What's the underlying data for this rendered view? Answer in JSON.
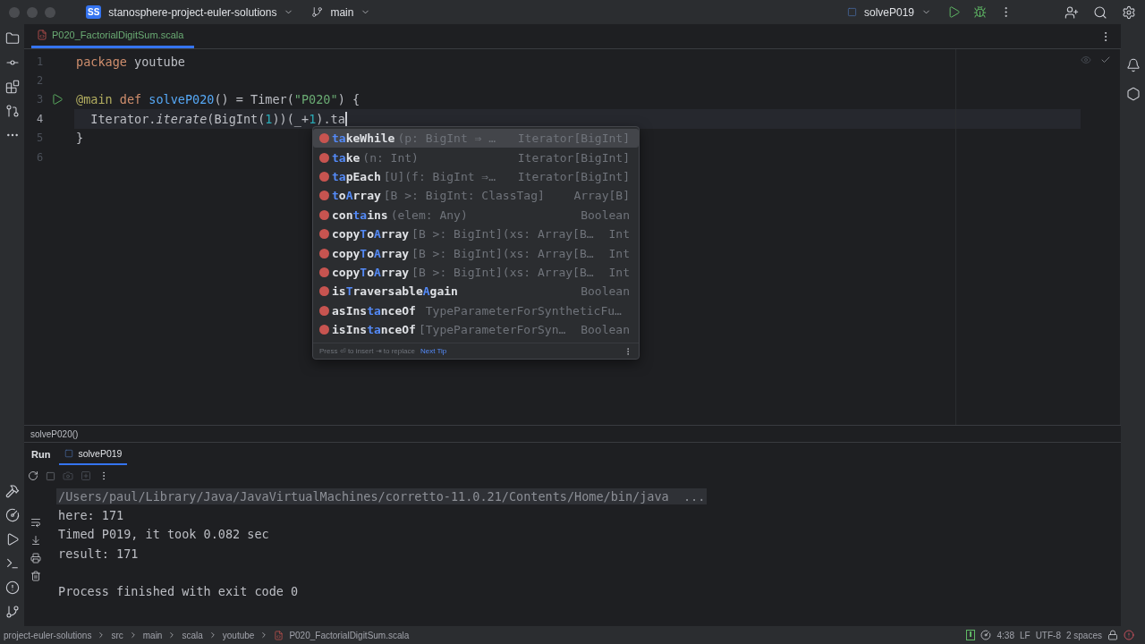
{
  "title_bar": {
    "project_badge": "SS",
    "project": "stanosphere-project-euler-solutions",
    "branch": "main",
    "run_config": "solveP019"
  },
  "editor_tabs": [
    {
      "label": "P020_FactorialDigitSum.scala",
      "selected": true
    }
  ],
  "code_lines": [
    {
      "number": "1",
      "run": false,
      "tokens": [
        {
          "text": "package",
          "kind": "keyword"
        },
        {
          "text": " youtube",
          "kind": "plain"
        }
      ]
    },
    {
      "number": "2",
      "run": false
    },
    {
      "number": "3",
      "run": true,
      "tokens": [
        {
          "text": "@main",
          "kind": "annotation"
        },
        {
          "text": " def ",
          "kind": "keyword"
        },
        {
          "text": "solveP020",
          "kind": "def"
        },
        {
          "text": "() = Timer(",
          "kind": "plain"
        },
        {
          "text": "\"P020\"",
          "kind": "string"
        },
        {
          "text": ") {",
          "kind": "plain"
        }
      ]
    },
    {
      "number": "4",
      "run": false,
      "current": true,
      "tokens": [
        {
          "text": "  Iterator.",
          "kind": "plain"
        },
        {
          "text": "iterate",
          "kind": "italic"
        },
        {
          "text": "(BigInt(",
          "kind": "plain"
        },
        {
          "text": "1",
          "kind": "number"
        },
        {
          "text": "))(_+",
          "kind": "plain"
        },
        {
          "text": "1",
          "kind": "number"
        },
        {
          "text": ").ta",
          "kind": "plain"
        }
      ]
    },
    {
      "number": "5",
      "run": false,
      "tokens": [
        {
          "text": "}",
          "kind": "plain"
        }
      ]
    },
    {
      "number": "6",
      "run": false
    }
  ],
  "completion": {
    "items": [
      {
        "name": [
          {
            "text": "ta",
            "match": true
          },
          {
            "text": "keWhile",
            "match": false
          }
        ],
        "signature": "(p: BigInt ⇒ …",
        "type": "Iterator[BigInt]",
        "selected": true
      },
      {
        "name": [
          {
            "text": "ta",
            "match": true
          },
          {
            "text": "ke",
            "match": false
          }
        ],
        "signature": "(n: Int)",
        "type": "Iterator[BigInt]",
        "selected": false
      },
      {
        "name": [
          {
            "text": "ta",
            "match": true
          },
          {
            "text": "pEach",
            "match": false
          }
        ],
        "signature": "[U](f: BigInt ⇒…",
        "type": "Iterator[BigInt]",
        "selected": false
      },
      {
        "name": [
          {
            "text": "t",
            "match": true
          },
          {
            "text": "o",
            "match": false
          },
          {
            "text": "A",
            "match": true
          },
          {
            "text": "rray",
            "match": false
          }
        ],
        "signature": "[B >: BigInt: ClassTag]",
        "type": "Array[B]",
        "selected": false
      },
      {
        "name": [
          {
            "text": "con",
            "match": false
          },
          {
            "text": "ta",
            "match": true
          },
          {
            "text": "ins",
            "match": false
          }
        ],
        "signature": "(elem: Any)",
        "type": "Boolean",
        "selected": false
      },
      {
        "name": [
          {
            "text": "copy",
            "match": false
          },
          {
            "text": "T",
            "match": true
          },
          {
            "text": "o",
            "match": false
          },
          {
            "text": "A",
            "match": true
          },
          {
            "text": "rray",
            "match": false
          }
        ],
        "signature": "[B >: BigInt](xs: Array[B…",
        "type": "Int",
        "selected": false
      },
      {
        "name": [
          {
            "text": "copy",
            "match": false
          },
          {
            "text": "T",
            "match": true
          },
          {
            "text": "o",
            "match": false
          },
          {
            "text": "A",
            "match": true
          },
          {
            "text": "rray",
            "match": false
          }
        ],
        "signature": "[B >: BigInt](xs: Array[B…",
        "type": "Int",
        "selected": false
      },
      {
        "name": [
          {
            "text": "copy",
            "match": false
          },
          {
            "text": "T",
            "match": true
          },
          {
            "text": "o",
            "match": false
          },
          {
            "text": "A",
            "match": true
          },
          {
            "text": "rray",
            "match": false
          }
        ],
        "signature": "[B >: BigInt](xs: Array[B…",
        "type": "Int",
        "selected": false
      },
      {
        "name": [
          {
            "text": "is",
            "match": false
          },
          {
            "text": "T",
            "match": true
          },
          {
            "text": "raversable",
            "match": false
          },
          {
            "text": "A",
            "match": true
          },
          {
            "text": "gain",
            "match": false
          }
        ],
        "type": "Boolean",
        "selected": false
      },
      {
        "name": [
          {
            "text": "asIns",
            "match": false
          },
          {
            "text": "ta",
            "match": true
          },
          {
            "text": "nceOf",
            "match": false
          }
        ],
        "signature": " TypeParameterForSyntheticFu…",
        "selected": false
      },
      {
        "name": [
          {
            "text": "isIns",
            "match": false
          },
          {
            "text": "ta",
            "match": true
          },
          {
            "text": "nceOf",
            "match": false
          }
        ],
        "signature": "[TypeParameterForSyn…",
        "type": "Boolean",
        "selected": false
      }
    ],
    "hint": "Press ⏎ to insert  ⇥ to replace",
    "tip_link": "Next Tip"
  },
  "breadcrumb": "solveP020()",
  "run_panel": {
    "title": "Run",
    "tabs": [
      {
        "label": "solveP019",
        "selected": true
      }
    ],
    "lines": [
      {
        "text": "/Users/paul/Library/Java/JavaVirtualMachines/corretto-11.0.21/Contents/Home/bin/java  ...",
        "kind": "command"
      },
      {
        "text": "here: 171",
        "kind": "output"
      },
      {
        "text": "Timed P019, it took 0.082 sec",
        "kind": "output"
      },
      {
        "text": "result: 171",
        "kind": "output"
      },
      {
        "kind": "blank"
      },
      {
        "text": "Process finished with exit code 0",
        "kind": "output"
      }
    ]
  },
  "status_bar": {
    "path": [
      "project-euler-solutions",
      "src",
      "main",
      "scala",
      "youtube",
      "P020_FactorialDigitSum.scala"
    ],
    "position": "4:38",
    "line_ending": "LF",
    "encoding": "UTF-8",
    "indent": "2 spaces"
  }
}
